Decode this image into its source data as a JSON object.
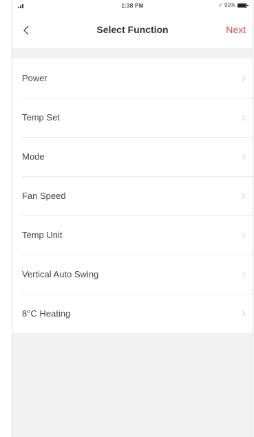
{
  "status_bar": {
    "time": "1:38 PM",
    "battery_text": "✓ 90%",
    "battery_level": 0.9
  },
  "nav": {
    "title": "Select Function",
    "next_label": "Next",
    "accent_color": "#e8424a"
  },
  "functions": [
    {
      "label": "Power"
    },
    {
      "label": "Temp Set"
    },
    {
      "label": "Mode"
    },
    {
      "label": "Fan Speed"
    },
    {
      "label": "Temp Unit"
    },
    {
      "label": "Vertical Auto Swing"
    },
    {
      "label": "8°C Heating"
    }
  ],
  "icons": {
    "back": "chevron-left-icon",
    "row_arrow": "chevron-right-icon",
    "signal": "cellular-signal-icon",
    "battery": "battery-icon"
  }
}
